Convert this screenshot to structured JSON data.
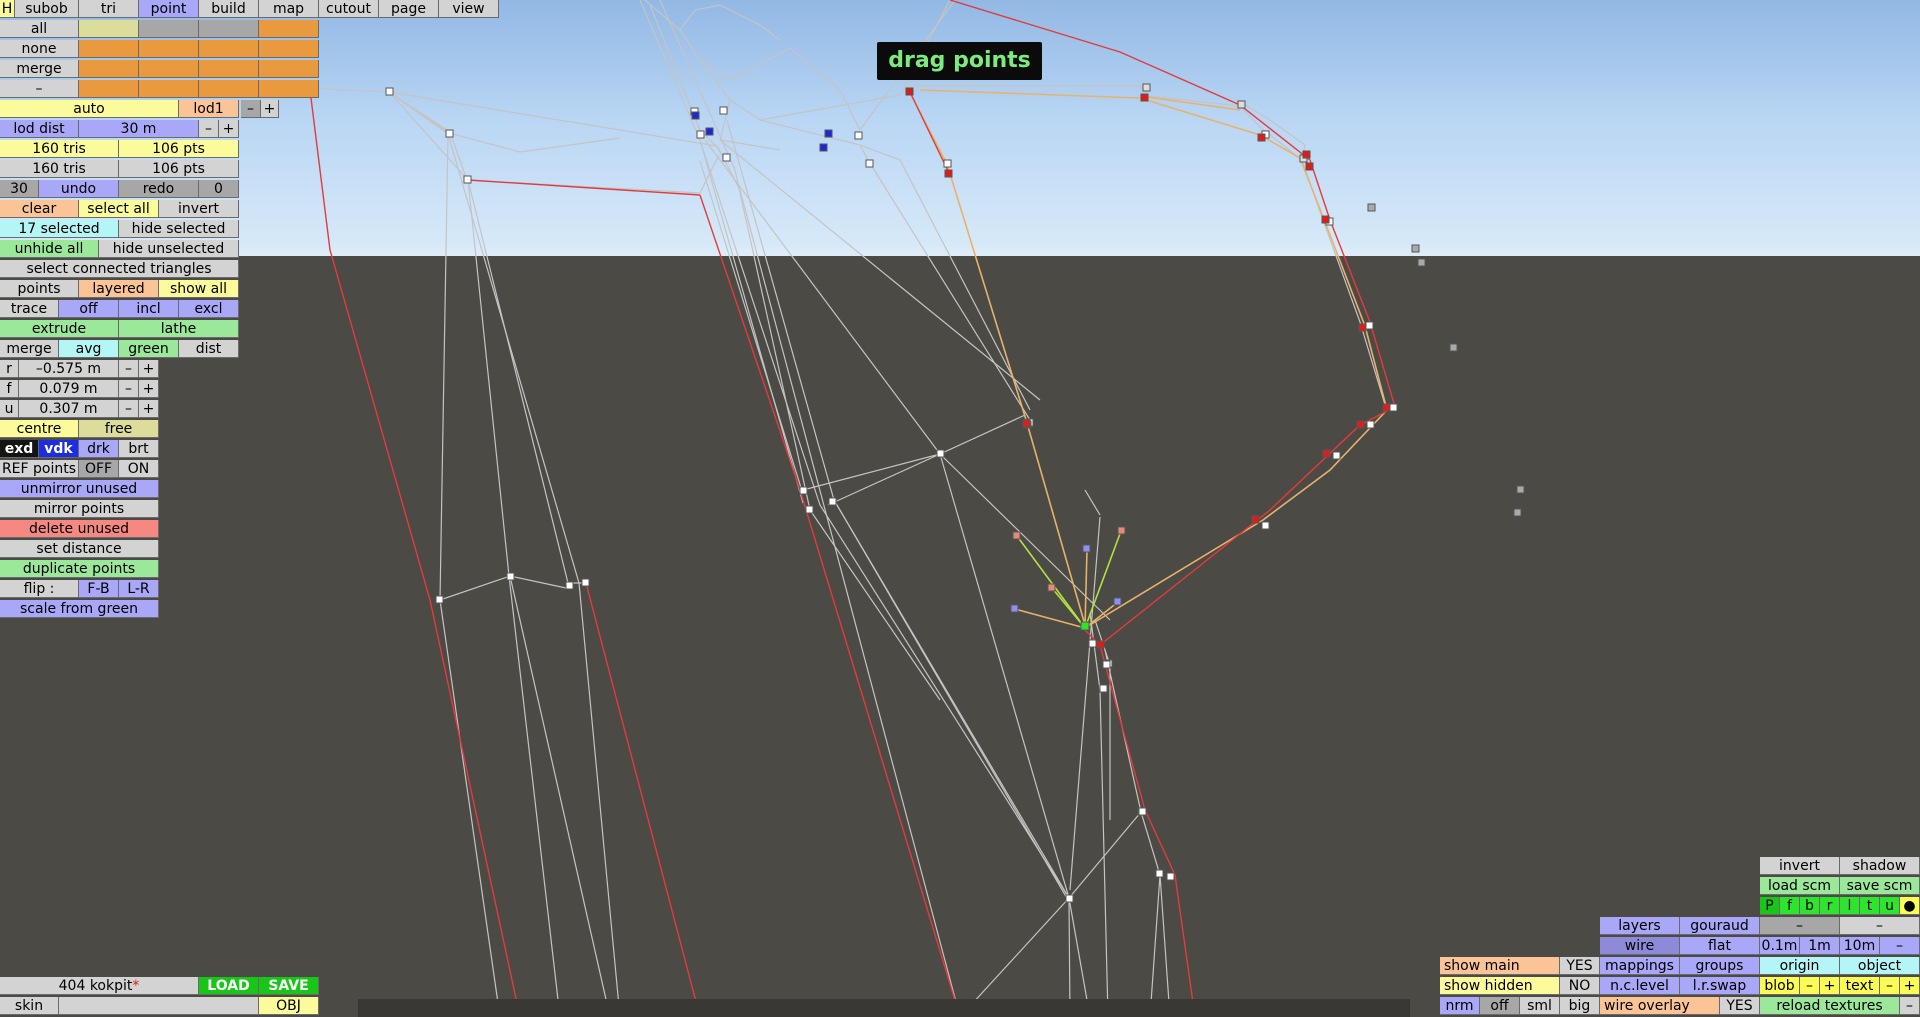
{
  "tooltip": "drag points",
  "top_menu": {
    "h": "H",
    "subob": "subob",
    "tri": "tri",
    "point": "point",
    "build": "build",
    "map": "map",
    "cutout": "cutout",
    "page": "page",
    "view": "view"
  },
  "selection_rows": {
    "all": "all",
    "none": "none",
    "merge": "merge",
    "minus": "–"
  },
  "lod": {
    "auto": "auto",
    "level": "lod1",
    "minus": "–",
    "plus": "+",
    "dist_label": "lod dist",
    "dist_value": "30 m"
  },
  "stats": {
    "tris1": "160 tris",
    "pts1": "106 pts",
    "tris2": "160 tris",
    "pts2": "106 pts"
  },
  "undo": {
    "count": "30",
    "undo": "undo",
    "redo": "redo",
    "redo_count": "0"
  },
  "select": {
    "clear": "clear",
    "select_all": "select all",
    "invert": "invert",
    "selected": "17 selected",
    "hide_selected": "hide selected",
    "unhide_all": "unhide all",
    "hide_unselected": "hide unselected",
    "connected": "select connected triangles"
  },
  "view_opts": {
    "points": "points",
    "layered": "layered",
    "show_all": "show all",
    "trace": "trace",
    "off": "off",
    "incl": "incl",
    "excl": "excl"
  },
  "ops": {
    "extrude": "extrude",
    "lathe": "lathe",
    "merge": "merge",
    "avg": "avg",
    "green": "green",
    "dist": "dist"
  },
  "coords": {
    "r_label": "r",
    "r_value": "–0.575 m",
    "f_label": "f",
    "f_value": "0.079 m",
    "u_label": "u",
    "u_value": "0.307 m",
    "minus": "–",
    "plus": "+"
  },
  "mode": {
    "centre": "centre",
    "free": "free",
    "exd": "exd",
    "vdk": "vdk",
    "drk": "drk",
    "brt": "brt",
    "ref_points": "REF points",
    "off": "OFF",
    "on": "ON"
  },
  "actions": {
    "unmirror": "unmirror unused",
    "mirror": "mirror points",
    "delete": "delete unused",
    "set_distance": "set distance",
    "duplicate": "duplicate points",
    "flip": "flip :",
    "fb": "F-B",
    "lr": "L-R",
    "scale": "scale from green"
  },
  "file": {
    "name": "404 kokpit",
    "modified": "*",
    "load": "LOAD",
    "save": "SAVE",
    "skin": "skin",
    "obj": "OBJ"
  },
  "right_panel": {
    "invert": "invert",
    "shadow": "shadow",
    "load_scm": "load scm",
    "save_scm": "save scm",
    "letters": [
      "P",
      "f",
      "b",
      "r",
      "l",
      "t",
      "u",
      "●"
    ],
    "layers": "layers",
    "gouraud": "gouraud",
    "dash": "–",
    "wire": "wire",
    "flat": "flat",
    "g01": "0.1m",
    "g1": "1m",
    "g10": "10m",
    "show_main": "show main",
    "yes": "YES",
    "mappings": "mappings",
    "groups": "groups",
    "origin": "origin",
    "object": "object",
    "show_hidden": "show hidden",
    "no": "NO",
    "nc_level": "n.c.level",
    "lr_swap": "l.r.swap",
    "blob": "blob",
    "text": "text",
    "plus": "+",
    "nrm": "nrm",
    "off": "off",
    "sml": "sml",
    "big": "big",
    "wire_overlay": "wire overlay",
    "reload": "reload textures"
  }
}
